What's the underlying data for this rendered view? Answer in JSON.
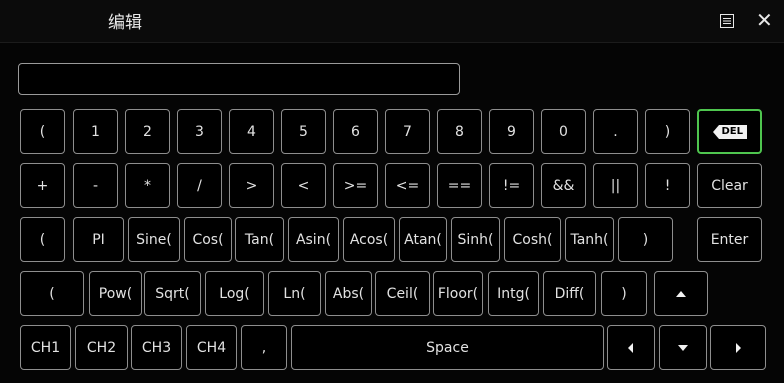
{
  "window": {
    "title": "编辑"
  },
  "display": {
    "value": ""
  },
  "rows": [
    [
      {
        "name": "key-open-paren-1",
        "label": "("
      },
      {
        "name": "key-1",
        "label": "1"
      },
      {
        "name": "key-2",
        "label": "2"
      },
      {
        "name": "key-3",
        "label": "3"
      },
      {
        "name": "key-4",
        "label": "4"
      },
      {
        "name": "key-5",
        "label": "5"
      },
      {
        "name": "key-6",
        "label": "6"
      },
      {
        "name": "key-7",
        "label": "7"
      },
      {
        "name": "key-8",
        "label": "8"
      },
      {
        "name": "key-9",
        "label": "9"
      },
      {
        "name": "key-0",
        "label": "0"
      },
      {
        "name": "key-dot",
        "label": "."
      },
      {
        "name": "key-close-paren-1",
        "label": ")"
      },
      {
        "name": "delete-button",
        "label": "DEL",
        "icon": "backspace-icon"
      }
    ],
    [
      {
        "name": "key-plus",
        "label": "+"
      },
      {
        "name": "key-minus",
        "label": "-"
      },
      {
        "name": "key-multiply",
        "label": "*"
      },
      {
        "name": "key-divide",
        "label": "/"
      },
      {
        "name": "key-greater",
        "label": ">"
      },
      {
        "name": "key-less",
        "label": "<"
      },
      {
        "name": "key-greater-equal",
        "label": ">="
      },
      {
        "name": "key-less-equal",
        "label": "<="
      },
      {
        "name": "key-equal",
        "label": "=="
      },
      {
        "name": "key-not-equal",
        "label": "!="
      },
      {
        "name": "key-and",
        "label": "&&"
      },
      {
        "name": "key-or",
        "label": "||"
      },
      {
        "name": "key-not",
        "label": "!"
      },
      {
        "name": "clear-button",
        "label": "Clear"
      }
    ],
    [
      {
        "name": "key-open-paren-2",
        "label": "("
      },
      {
        "name": "key-pi",
        "label": "PI"
      },
      {
        "name": "key-sine",
        "label": "Sine("
      },
      {
        "name": "key-cos",
        "label": "Cos("
      },
      {
        "name": "key-tan",
        "label": "Tan("
      },
      {
        "name": "key-asin",
        "label": "Asin("
      },
      {
        "name": "key-acos",
        "label": "Acos("
      },
      {
        "name": "key-atan",
        "label": "Atan("
      },
      {
        "name": "key-sinh",
        "label": "Sinh("
      },
      {
        "name": "key-cosh",
        "label": "Cosh("
      },
      {
        "name": "key-tanh",
        "label": "Tanh("
      },
      {
        "name": "key-close-paren-2",
        "label": ")"
      },
      {
        "name": "enter-button",
        "label": "Enter"
      }
    ],
    [
      {
        "name": "key-open-paren-3",
        "label": "("
      },
      {
        "name": "key-pow",
        "label": "Pow("
      },
      {
        "name": "key-sqrt",
        "label": "Sqrt("
      },
      {
        "name": "key-log",
        "label": "Log("
      },
      {
        "name": "key-ln",
        "label": "Ln("
      },
      {
        "name": "key-abs",
        "label": "Abs("
      },
      {
        "name": "key-ceil",
        "label": "Ceil("
      },
      {
        "name": "key-floor",
        "label": "Floor("
      },
      {
        "name": "key-intg",
        "label": "Intg("
      },
      {
        "name": "key-diff",
        "label": "Diff("
      },
      {
        "name": "key-close-paren-3",
        "label": ")"
      },
      {
        "name": "arrow-up-button",
        "label": "",
        "icon": "arrow-up-icon"
      }
    ],
    [
      {
        "name": "key-ch1",
        "label": "CH1"
      },
      {
        "name": "key-ch2",
        "label": "CH2"
      },
      {
        "name": "key-ch3",
        "label": "CH3"
      },
      {
        "name": "key-ch4",
        "label": "CH4"
      },
      {
        "name": "key-comma",
        "label": ","
      },
      {
        "name": "space-button",
        "label": "Space"
      },
      {
        "name": "arrow-left-button",
        "label": "",
        "icon": "arrow-left-icon"
      },
      {
        "name": "arrow-down-button",
        "label": "",
        "icon": "arrow-down-icon"
      },
      {
        "name": "arrow-right-button",
        "label": "",
        "icon": "arrow-right-icon"
      }
    ]
  ],
  "colors": {
    "key_border": "#8e8e8e",
    "accent_green": "#4fc64f",
    "background": "#050505"
  }
}
